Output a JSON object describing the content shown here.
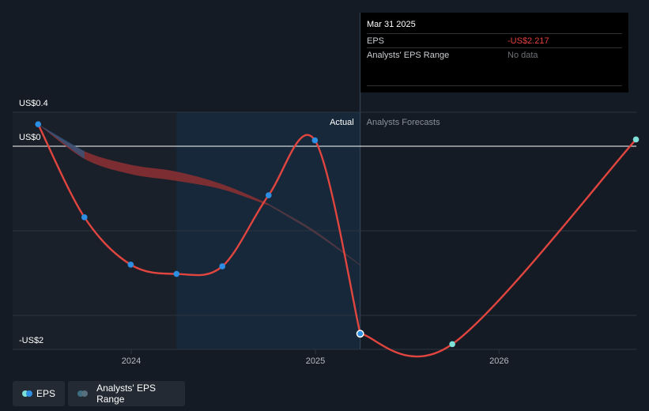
{
  "colors": {
    "background": "#151b24",
    "eps_line": "#e0453f",
    "eps_marker": "#2d8fe3",
    "forecast_marker": "#7fe0d8",
    "range_band": "#8e3032",
    "actual_region": "#16283a",
    "tooltip_negative": "#e64040"
  },
  "tooltip": {
    "date": "Mar 31 2025",
    "eps_label": "EPS",
    "eps_value": "-US$2.217",
    "range_label": "Analysts' EPS Range",
    "range_value": "No data"
  },
  "legend": {
    "eps_label": "EPS",
    "range_label": "Analysts' EPS Range"
  },
  "chart_data": {
    "type": "line",
    "y_axis_labels": [
      "US$0.4",
      "US$0",
      "-US$2"
    ],
    "x_tick_labels": [
      "2024",
      "2025",
      "2026"
    ],
    "region_labels": {
      "actual": "Actual",
      "forecast": "Analysts Forecasts"
    },
    "ylim": [
      -2.3,
      0.4
    ],
    "grid": true,
    "legend_position": "bottom-left",
    "series": [
      {
        "name": "EPS",
        "kind": "actual",
        "x": [
          "2023-06-30",
          "2023-09-30",
          "2023-12-31",
          "2024-03-31",
          "2024-06-30",
          "2024-09-30",
          "2024-12-31",
          "2025-03-31"
        ],
        "values": [
          0.26,
          -0.84,
          -1.4,
          -1.51,
          -1.42,
          -0.58,
          0.07,
          -2.217
        ]
      },
      {
        "name": "EPS",
        "kind": "forecast",
        "x": [
          "2025-03-31",
          "2025-09-30",
          "2026-09-30"
        ],
        "values": [
          -2.217,
          -2.34,
          0.08
        ]
      },
      {
        "name": "Analysts' EPS Range",
        "kind": "range",
        "x": [
          "2023-06-30",
          "2023-09-30",
          "2023-12-31",
          "2024-03-31",
          "2024-06-30",
          "2024-09-30",
          "2024-12-31",
          "2025-03-31"
        ],
        "low": [
          0.26,
          -0.15,
          -0.33,
          -0.41,
          -0.51,
          -0.7,
          -1.03,
          -1.41
        ],
        "high": [
          0.26,
          -0.06,
          -0.22,
          -0.3,
          -0.45,
          -0.68,
          -1.0,
          -1.4
        ]
      }
    ]
  }
}
